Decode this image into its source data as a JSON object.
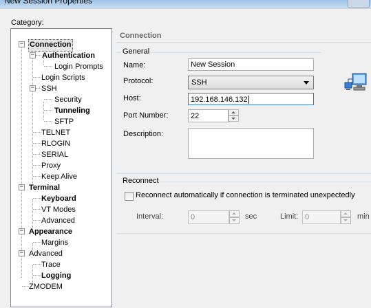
{
  "window": {
    "title": "New Session Properties"
  },
  "category_label": "Category:",
  "tree": {
    "items": [
      {
        "label": "Connection",
        "bold": true,
        "selected": true
      },
      {
        "label": "Authentication",
        "bold": true
      },
      {
        "label": "Login Prompts",
        "bold": false
      },
      {
        "label": "Login Scripts",
        "bold": false
      },
      {
        "label": "SSH",
        "bold": false
      },
      {
        "label": "Security",
        "bold": false
      },
      {
        "label": "Tunneling",
        "bold": true
      },
      {
        "label": "SFTP",
        "bold": false
      },
      {
        "label": "TELNET",
        "bold": false
      },
      {
        "label": "RLOGIN",
        "bold": false
      },
      {
        "label": "SERIAL",
        "bold": false
      },
      {
        "label": "Proxy",
        "bold": false
      },
      {
        "label": "Keep Alive",
        "bold": false
      },
      {
        "label": "Terminal",
        "bold": true
      },
      {
        "label": "Keyboard",
        "bold": true
      },
      {
        "label": "VT Modes",
        "bold": false
      },
      {
        "label": "Advanced",
        "bold": false
      },
      {
        "label": "Appearance",
        "bold": true
      },
      {
        "label": "Margins",
        "bold": false
      },
      {
        "label": "Advanced",
        "bold": false
      },
      {
        "label": "Trace",
        "bold": false
      },
      {
        "label": "Logging",
        "bold": true
      },
      {
        "label": "ZMODEM",
        "bold": false
      }
    ]
  },
  "panel": {
    "header": "Connection",
    "general": {
      "group_label": "General",
      "name_label": "Name:",
      "name_value": "New Session",
      "protocol_label": "Protocol:",
      "protocol_value": "SSH",
      "host_label": "Host:",
      "host_value": "192.168.146.132",
      "port_label": "Port Number:",
      "port_value": "22",
      "description_label": "Description:",
      "description_value": ""
    },
    "reconnect": {
      "group_label": "Reconnect",
      "checkbox_label": "Reconnect automatically if connection is terminated unexpectedly",
      "interval_label": "Interval:",
      "interval_value": "0",
      "sec_label": "sec",
      "limit_label": "Limit:",
      "limit_value": "0",
      "min_label": "min"
    }
  },
  "icons": {
    "network": "network-computers-icon"
  }
}
